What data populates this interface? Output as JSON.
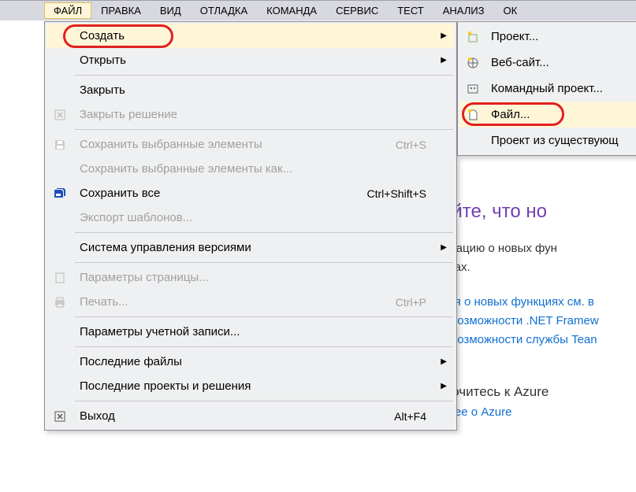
{
  "menubar": {
    "items": [
      "ФАЙЛ",
      "ПРАВКА",
      "ВИД",
      "ОТЛАДКА",
      "КОМАНДА",
      "СЕРВИС",
      "ТЕСТ",
      "АНАЛИЗ",
      "ОК"
    ]
  },
  "file_menu": {
    "create": "Создать",
    "open": "Открыть",
    "close": "Закрыть",
    "close_solution": "Закрыть решение",
    "save_selected": "Сохранить выбранные элементы",
    "save_selected_shortcut": "Ctrl+S",
    "save_selected_as": "Сохранить выбранные элементы как...",
    "save_all": "Сохранить все",
    "save_all_shortcut": "Ctrl+Shift+S",
    "export_templates": "Экспорт шаблонов...",
    "source_control": "Система управления версиями",
    "page_setup": "Параметры страницы...",
    "print": "Печать...",
    "print_shortcut": "Ctrl+P",
    "account_settings": "Параметры учетной записи...",
    "recent_files": "Последние файлы",
    "recent_projects": "Последние проекты и решения",
    "exit": "Выход",
    "exit_shortcut": "Alt+F4"
  },
  "create_submenu": {
    "project": "Проект...",
    "website": "Веб-сайт...",
    "team_project": "Командный проект...",
    "file": "Файл...",
    "from_existing": "Проект из существующ"
  },
  "background": {
    "heading_fragment": "айте, что но",
    "text1": "рмацию о новых фун",
    "text2": "елах.",
    "link1": "ния о новых функциях см. в",
    "link2": "е возможности .NET Framew",
    "link3": "е возможности службы Tean",
    "azure1": "лючитесь к Azure",
    "azure2": "бнее о Azure"
  }
}
